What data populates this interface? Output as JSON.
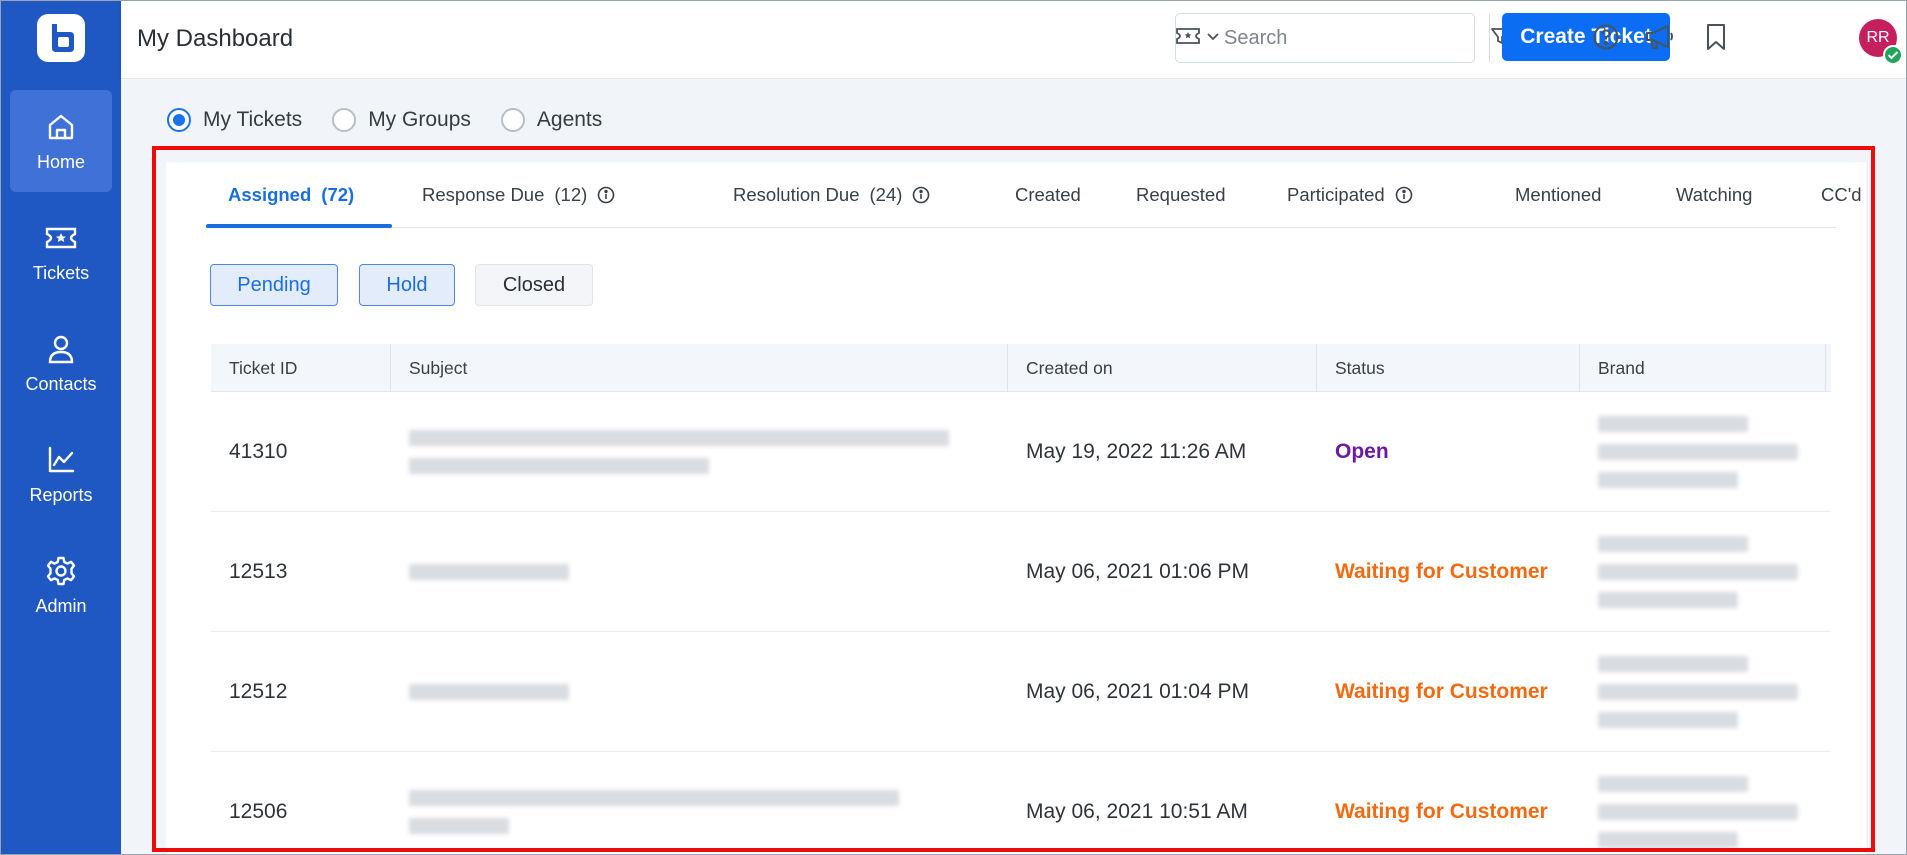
{
  "sidebar": {
    "logo_icon": "app-logo-icon",
    "items": [
      {
        "label": "Home",
        "icon": "home-icon",
        "active": true
      },
      {
        "label": "Tickets",
        "icon": "ticket-icon",
        "active": false
      },
      {
        "label": "Contacts",
        "icon": "person-icon",
        "active": false
      },
      {
        "label": "Reports",
        "icon": "chart-line-icon",
        "active": false
      },
      {
        "label": "Admin",
        "icon": "gear-icon",
        "active": false
      }
    ]
  },
  "header": {
    "title": "My Dashboard",
    "search_placeholder": "Search",
    "create_label": "Create Ticket",
    "avatar_initials": "RR",
    "icons": [
      "help-icon",
      "announcement-icon",
      "bookmark-icon"
    ]
  },
  "view_options": [
    {
      "label": "My Tickets",
      "checked": true
    },
    {
      "label": "My Groups",
      "checked": false
    },
    {
      "label": "Agents",
      "checked": false
    }
  ],
  "tabs": [
    {
      "label": "Assigned",
      "count": "(72)",
      "active": true,
      "info": false
    },
    {
      "label": "Response Due",
      "count": "(12)",
      "active": false,
      "info": true
    },
    {
      "label": "Resolution Due",
      "count": "(24)",
      "active": false,
      "info": true
    },
    {
      "label": "Created",
      "count": "",
      "active": false,
      "info": false
    },
    {
      "label": "Requested",
      "count": "",
      "active": false,
      "info": false
    },
    {
      "label": "Participated",
      "count": "",
      "active": false,
      "info": true
    },
    {
      "label": "Mentioned",
      "count": "",
      "active": false,
      "info": false
    },
    {
      "label": "Watching",
      "count": "",
      "active": false,
      "info": false
    },
    {
      "label": "CC'd",
      "count": "",
      "active": false,
      "info": false
    }
  ],
  "filters": [
    {
      "label": "Pending",
      "selected": true
    },
    {
      "label": "Hold",
      "selected": true
    },
    {
      "label": "Closed",
      "selected": false
    }
  ],
  "table": {
    "columns": [
      "Ticket ID",
      "Subject",
      "Created on",
      "Status",
      "Brand"
    ],
    "rows": [
      {
        "id": "41310",
        "created": "May 19, 2022 11:26 AM",
        "status": "Open",
        "status_kind": "open"
      },
      {
        "id": "12513",
        "created": "May 06, 2021 01:06 PM",
        "status": "Waiting for Customer",
        "status_kind": "wait"
      },
      {
        "id": "12512",
        "created": "May 06, 2021 01:04 PM",
        "status": "Waiting for Customer",
        "status_kind": "wait"
      },
      {
        "id": "12506",
        "created": "May 06, 2021 10:51 AM",
        "status": "Waiting for Customer",
        "status_kind": "wait"
      }
    ]
  },
  "colors": {
    "sidebar": "#1f57c3",
    "accent": "#0b6cf4",
    "status_open": "#6a1aa8",
    "status_waiting": "#f26a12",
    "highlight": "#ee0b0b"
  }
}
